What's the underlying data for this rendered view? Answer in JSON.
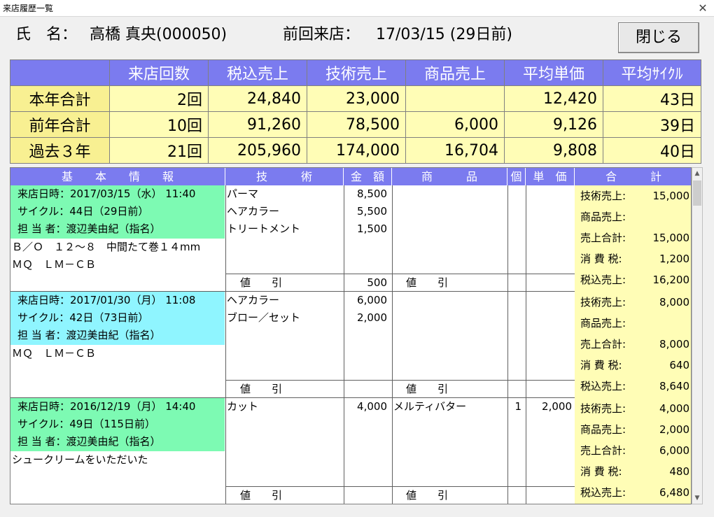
{
  "window": {
    "title": "来店履歴一覧"
  },
  "header": {
    "name_label": "氏　名：",
    "name_value": "高橋 真央(000050)",
    "last_visit_label": "前回来店：",
    "last_visit_value": "17/03/15 (29日前)",
    "close_button": "閉じる"
  },
  "summary": {
    "columns": [
      "来店回数",
      "税込売上",
      "技術売上",
      "商品売上",
      "平均単価",
      "平均ｻｲｸﾙ"
    ],
    "rows": [
      {
        "label": "本年合計",
        "cells": [
          "2回",
          "24,840",
          "23,000",
          "",
          "12,420",
          "43日"
        ]
      },
      {
        "label": "前年合計",
        "cells": [
          "10回",
          "91,260",
          "78,500",
          "6,000",
          "9,126",
          "39日"
        ]
      },
      {
        "label": "過去３年",
        "cells": [
          "21回",
          "205,960",
          "174,000",
          "16,704",
          "9,808",
          "40日"
        ]
      }
    ]
  },
  "grid": {
    "headers": {
      "basic": "基　　本　　情　　報",
      "tech": "技　　　術",
      "amount": "金　額",
      "product": "商　　　品",
      "qty": "個",
      "unit": "単　価",
      "total": "合　　　計"
    },
    "discount_label": "値　　引",
    "records": [
      {
        "date_line": "来店日時：2017/03/15（水） 11:40",
        "cycle_line": "サイクル：44日（29日前）",
        "staff_line": "担 当 者：渡辺美由紀（指名）",
        "note_lines": [
          "Ｂ／Ｏ　１２～８　中間たて巻１４mm",
          "ＭＱ　ＬＭ－ＣＢ"
        ],
        "tech_items": [
          {
            "name": "パーマ",
            "amount": "8,500"
          },
          {
            "name": "ヘアカラー",
            "amount": "5,500"
          },
          {
            "name": "トリートメント",
            "amount": "1,500"
          }
        ],
        "tech_discount": "500",
        "products": [],
        "totals": [
          {
            "label": "技術売上:",
            "value": "15,000"
          },
          {
            "label": "商品売上:",
            "value": ""
          },
          {
            "label": "売上合計:",
            "value": "15,000"
          },
          {
            "label": "消 費 税:",
            "value": "1,200"
          },
          {
            "label": "税込売上:",
            "value": "16,200"
          }
        ]
      },
      {
        "date_line": "来店日時：2017/01/30（月） 11:08",
        "cycle_line": "サイクル：42日（73日前）",
        "staff_line": "担 当 者：渡辺美由紀（指名）",
        "note_lines": [
          "ＭＱ　ＬＭ－ＣＢ"
        ],
        "tech_items": [
          {
            "name": "ヘアカラー",
            "amount": "6,000"
          },
          {
            "name": "ブロー／セット",
            "amount": "2,000"
          }
        ],
        "tech_discount": "",
        "products": [],
        "totals": [
          {
            "label": "技術売上:",
            "value": "8,000"
          },
          {
            "label": "商品売上:",
            "value": ""
          },
          {
            "label": "売上合計:",
            "value": "8,000"
          },
          {
            "label": "消 費 税:",
            "value": "640"
          },
          {
            "label": "税込売上:",
            "value": "8,640"
          }
        ]
      },
      {
        "date_line": "来店日時：2016/12/19（月） 14:40",
        "cycle_line": "サイクル：49日（115日前）",
        "staff_line": "担 当 者：渡辺美由紀（指名）",
        "note_lines": [
          "シュークリームをいただいた"
        ],
        "tech_items": [
          {
            "name": "カット",
            "amount": "4,000"
          }
        ],
        "tech_discount": "",
        "products": [
          {
            "name": "メルティバター",
            "qty": "1",
            "unit": "2,000"
          }
        ],
        "totals": [
          {
            "label": "技術売上:",
            "value": "4,000"
          },
          {
            "label": "商品売上:",
            "value": "2,000"
          },
          {
            "label": "売上合計:",
            "value": "6,000"
          },
          {
            "label": "消 費 税:",
            "value": "480"
          },
          {
            "label": "税込売上:",
            "value": "6,480"
          }
        ]
      }
    ]
  },
  "colors": {
    "header_blue": "#7b7bef",
    "yellow": "#fffdb6",
    "green": "#7dfab3",
    "cyan": "#8ff5ff"
  }
}
